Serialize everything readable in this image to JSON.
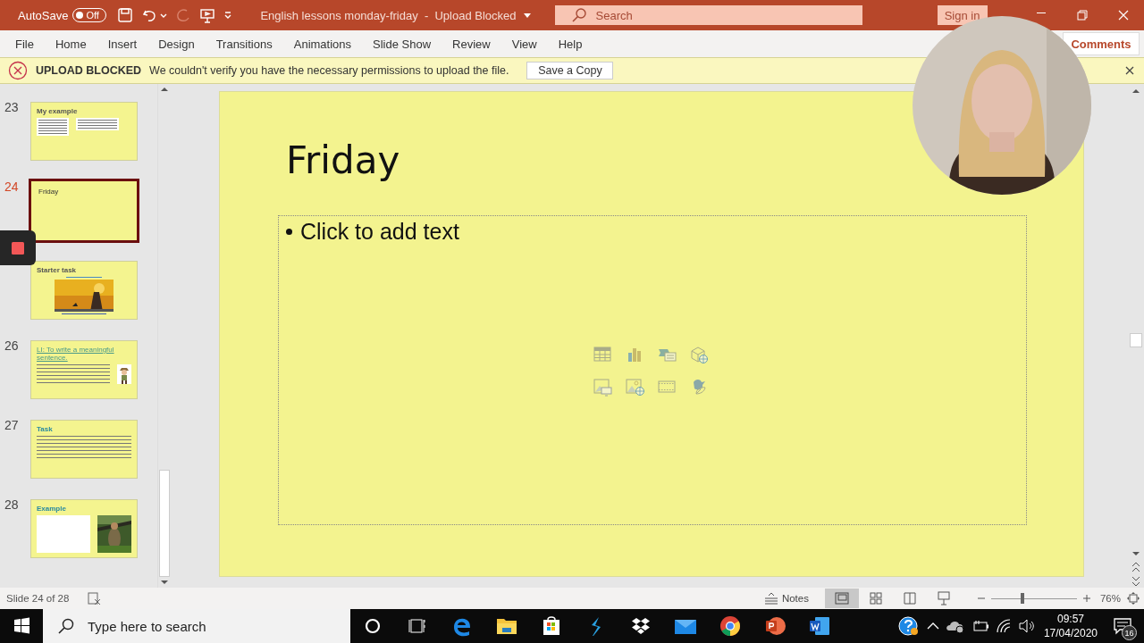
{
  "title_bar": {
    "autosave_label": "AutoSave",
    "autosave_on": false,
    "autosave_state": "Off",
    "document_title": "English lessons monday-friday  -  Upload Blocked",
    "search_placeholder": "Search",
    "sign_in": "Sign in"
  },
  "ribbon_tabs": [
    "File",
    "Home",
    "Insert",
    "Design",
    "Transitions",
    "Animations",
    "Slide Show",
    "Review",
    "View",
    "Help"
  ],
  "comments_button": "Comments",
  "message_bar": {
    "title": "UPLOAD BLOCKED",
    "message": "We couldn't verify you have the necessary permissions to upload the file.",
    "button": "Save a Copy"
  },
  "thumbnails": [
    {
      "number": "23",
      "title": "My example",
      "kind": "two-boxes",
      "selected": false
    },
    {
      "number": "24",
      "title": "Friday",
      "kind": "title-only",
      "selected": true
    },
    {
      "title": "Starter task",
      "kind": "video",
      "selected": false
    },
    {
      "number": "26",
      "title": "LI: To write a meaningful sentence.",
      "kind": "text-figure",
      "selected": false
    },
    {
      "number": "27",
      "title": "Task",
      "kind": "text",
      "selected": false
    },
    {
      "number": "28",
      "title": "Example",
      "kind": "text-photo",
      "selected": false
    }
  ],
  "slide": {
    "title": "Friday",
    "placeholder": "Click to add text"
  },
  "status_bar": {
    "slide_info": "Slide 24 of 28",
    "notes": "Notes",
    "zoom_slider": {
      "level": 0.36
    },
    "zoom": "76%"
  },
  "taskbar": {
    "search_placeholder": "Type here to search",
    "time": "09:57",
    "date": "17/04/2020",
    "notifications": "16"
  }
}
